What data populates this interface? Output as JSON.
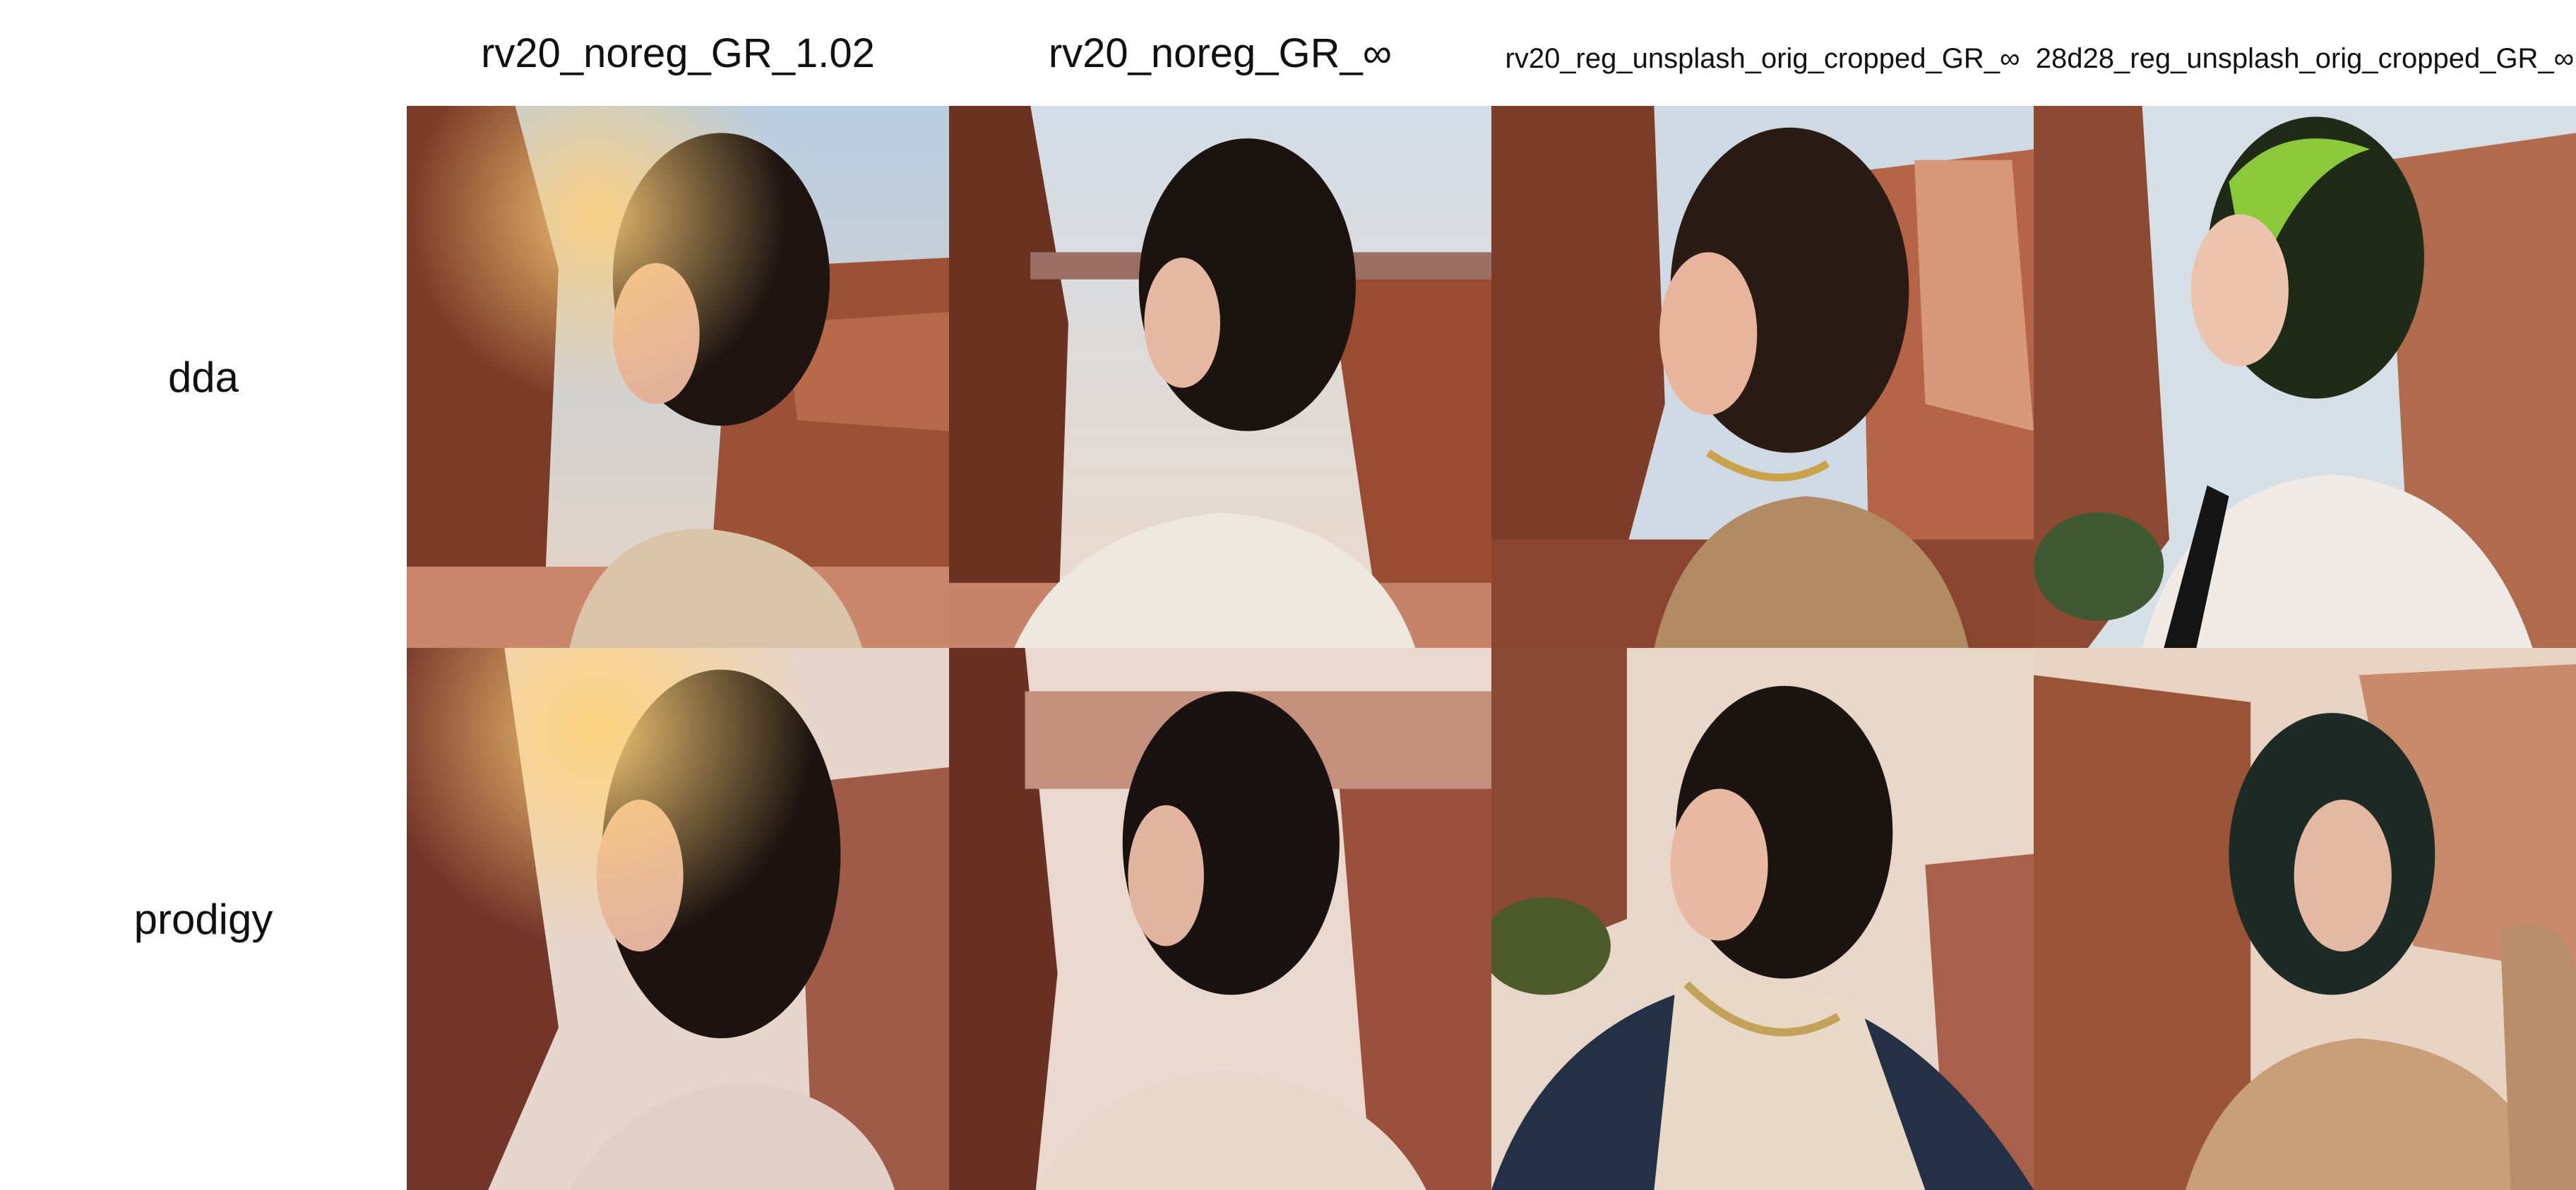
{
  "columns": [
    {
      "label": "rv20_noreg_GR_1.02"
    },
    {
      "label": "rv20_noreg_GR_∞"
    },
    {
      "label": "rv20_reg_unsplash_orig_cropped_GR_∞"
    },
    {
      "label": "28d28_reg_unsplash_orig_cropped_GR_∞"
    }
  ],
  "rows": [
    {
      "label": "dda"
    },
    {
      "label": "prodigy"
    }
  ],
  "palette": {
    "sky": "#cfd9e3",
    "rock_dark": "#6e3423",
    "rock_mid": "#a65a3e",
    "rock_light": "#d39a79",
    "hair_dark": "#1c1411",
    "hair_green": "#8bc83a",
    "skin": "#e7b7a1",
    "shirt_beige": "#d8c2a8",
    "shirt_white": "#efeae6",
    "jacket_navy": "#243045"
  }
}
